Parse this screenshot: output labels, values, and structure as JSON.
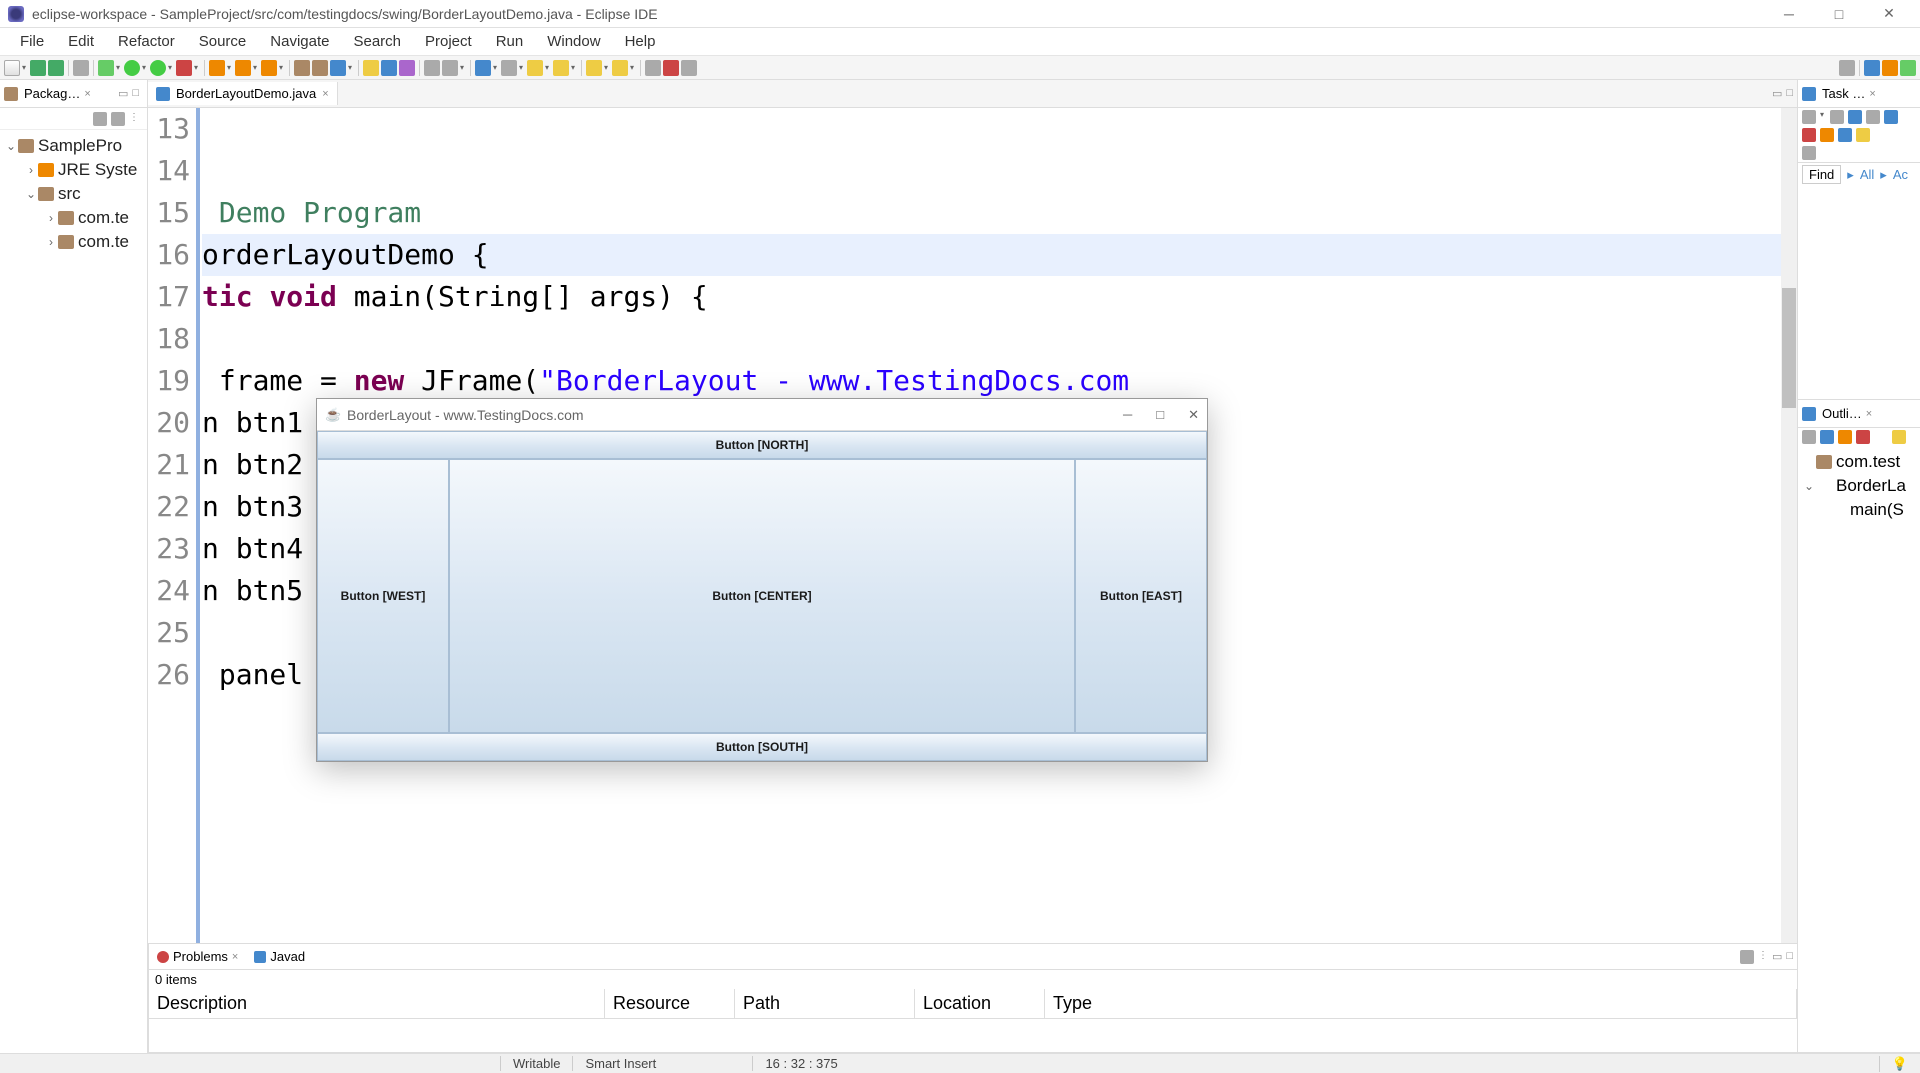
{
  "window": {
    "title": "eclipse-workspace - SampleProject/src/com/testingdocs/swing/BorderLayoutDemo.java - Eclipse IDE"
  },
  "menu": [
    "File",
    "Edit",
    "Refactor",
    "Source",
    "Navigate",
    "Search",
    "Project",
    "Run",
    "Window",
    "Help"
  ],
  "packageExplorer": {
    "title": "Packag…",
    "items": [
      {
        "label": "SamplePro",
        "indent": 0,
        "arrow": "⌄",
        "icon": "project"
      },
      {
        "label": "JRE Syste",
        "indent": 1,
        "arrow": "›",
        "icon": "library"
      },
      {
        "label": "src",
        "indent": 1,
        "arrow": "⌄",
        "icon": "src"
      },
      {
        "label": "com.te",
        "indent": 2,
        "arrow": "›",
        "icon": "package"
      },
      {
        "label": "com.te",
        "indent": 2,
        "arrow": "›",
        "icon": "package"
      }
    ]
  },
  "editor": {
    "tabName": "BorderLayoutDemo.java",
    "lines": [
      {
        "n": "13",
        "segments": [
          {
            "text": ""
          }
        ]
      },
      {
        "n": "14",
        "segments": [
          {
            "text": ""
          }
        ]
      },
      {
        "n": "15",
        "segments": [
          {
            "text": " Demo Program",
            "class": "kw-green"
          }
        ]
      },
      {
        "n": "16",
        "highlight": true,
        "segments": [
          {
            "text": "orderLayoutDemo {",
            "class": ""
          }
        ]
      },
      {
        "n": "17",
        "segments": [
          {
            "text": "tic",
            "class": "kw-purple"
          },
          {
            "text": " ",
            "class": ""
          },
          {
            "text": "void",
            "class": "kw-purple"
          },
          {
            "text": " main(String[] args) {",
            "class": ""
          }
        ]
      },
      {
        "n": "18",
        "segments": [
          {
            "text": ""
          }
        ]
      },
      {
        "n": "19",
        "segments": [
          {
            "text": " frame = ",
            "class": ""
          },
          {
            "text": "new",
            "class": "kw-purple"
          },
          {
            "text": " JFrame(",
            "class": ""
          },
          {
            "text": "\"BorderLayout - www.TestingDocs.com",
            "class": "str-blue"
          }
        ]
      },
      {
        "n": "20",
        "segments": [
          {
            "text": "n btn1",
            "class": ""
          }
        ]
      },
      {
        "n": "21",
        "segments": [
          {
            "text": "n btn2",
            "class": ""
          }
        ]
      },
      {
        "n": "22",
        "segments": [
          {
            "text": "n btn3",
            "class": ""
          }
        ]
      },
      {
        "n": "23",
        "segments": [
          {
            "text": "n btn4",
            "class": ""
          }
        ]
      },
      {
        "n": "24",
        "segments": [
          {
            "text": "n btn5",
            "class": ""
          }
        ]
      },
      {
        "n": "25",
        "segments": [
          {
            "text": ""
          }
        ]
      },
      {
        "n": "26",
        "segments": [
          {
            "text": " panel",
            "class": ""
          }
        ]
      }
    ]
  },
  "rightPanel": {
    "taskTab": "Task …",
    "findLabel": "Find",
    "allLabel": "All",
    "acLabel": "Ac",
    "outlineTab": "Outli…",
    "outline": [
      {
        "label": "com.test",
        "indent": 0,
        "arrow": ""
      },
      {
        "label": "BorderLa",
        "indent": 0,
        "arrow": "⌄"
      },
      {
        "label": "main(S",
        "indent": 1,
        "arrow": ""
      }
    ]
  },
  "problems": {
    "tab1": "Problems",
    "tab2": "Javad",
    "items": "0 items",
    "columns": [
      "Description",
      "Resource",
      "Path",
      "Location",
      "Type"
    ]
  },
  "statusBar": {
    "writable": "Writable",
    "insert": "Smart Insert",
    "position": "16 : 32 : 375"
  },
  "swingWindow": {
    "title": "BorderLayout - www.TestingDocs.com",
    "north": "Button [NORTH]",
    "south": "Button [SOUTH]",
    "west": "Button [WEST]",
    "center": "Button [CENTER]",
    "east": "Button [EAST]"
  }
}
